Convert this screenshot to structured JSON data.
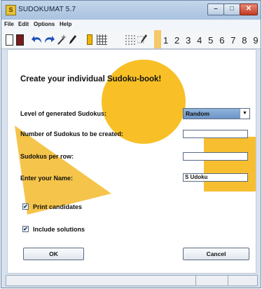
{
  "window": {
    "title": "SUDOKUMAT 5.7",
    "icon": "sudoku-app-icon",
    "min_label": "–",
    "max_label": "□",
    "close_label": "✕"
  },
  "menu": {
    "items": [
      "File",
      "Edit",
      "Options",
      "Help"
    ]
  },
  "toolbar": {
    "icons": [
      "new-document-icon",
      "book-icon",
      "undo-icon",
      "redo-icon",
      "magic-wand-icon",
      "pen-icon",
      "candidates-toggle-icon",
      "grid-small-icon",
      "grid-dots-icon",
      "grid-pen-icon"
    ],
    "digits": "1 2 3 4 5 6 7 8 9"
  },
  "dialog": {
    "heading": "Create your individual Sudoku-book!",
    "level_label": "Level of generated Sudokus:",
    "level_value": "Random",
    "count_label": "Number of Sudokus to be created:",
    "count_value": "",
    "per_row_label": "Sudokus per row:",
    "per_row_value": "",
    "name_label": "Enter your Name:",
    "name_value": "S Udoku",
    "print_candidates_label": "Print candidates",
    "print_candidates_checked": true,
    "include_solutions_label": "Include solutions",
    "include_solutions_checked": true,
    "check_mark": "✔",
    "ok_label": "OK",
    "cancel_label": "Cancel"
  },
  "colors": {
    "accent": "#f5b400",
    "selection": "#7aa1d2",
    "close": "#c23b21"
  }
}
